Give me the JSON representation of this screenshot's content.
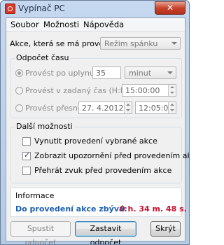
{
  "window": {
    "title": "Vypínač PC",
    "close_symbol": "✕"
  },
  "menu": [
    "Soubor",
    "Možnosti",
    "Nápověda"
  ],
  "action": {
    "label": "Akce, která se má provést:",
    "selected": "Režim spánku"
  },
  "countdown_group": {
    "title": "Odpočet času",
    "after": {
      "label": "Provést po uplynutí",
      "value": "35",
      "unit": "minut"
    },
    "at_time": {
      "label": "Provést v zadaný čas (H:M:S)",
      "value": "15:00:00"
    },
    "exact": {
      "label": "Provést přesně",
      "date": "27. 4.2012",
      "time": "12:05:02"
    }
  },
  "more_group": {
    "title": "Další možnosti",
    "options": [
      {
        "label": "Vynutit provedení vybrané akce",
        "checked": false
      },
      {
        "label": "Zobrazit upozornění před provedením akce",
        "checked": true
      },
      {
        "label": "Přehrát zvuk před provedením akce",
        "checked": false
      }
    ]
  },
  "info": {
    "title": "Informace",
    "text": "Do provedení akce zbývá:",
    "remaining": "0 h. 34 m. 48 s."
  },
  "buttons": {
    "start": "Spustit odpočet",
    "stop": "Zastavit odpočet",
    "hide": "Skrýt"
  },
  "colors": {
    "info_text": "#1b5fb0",
    "remaining": "#c8102e"
  }
}
